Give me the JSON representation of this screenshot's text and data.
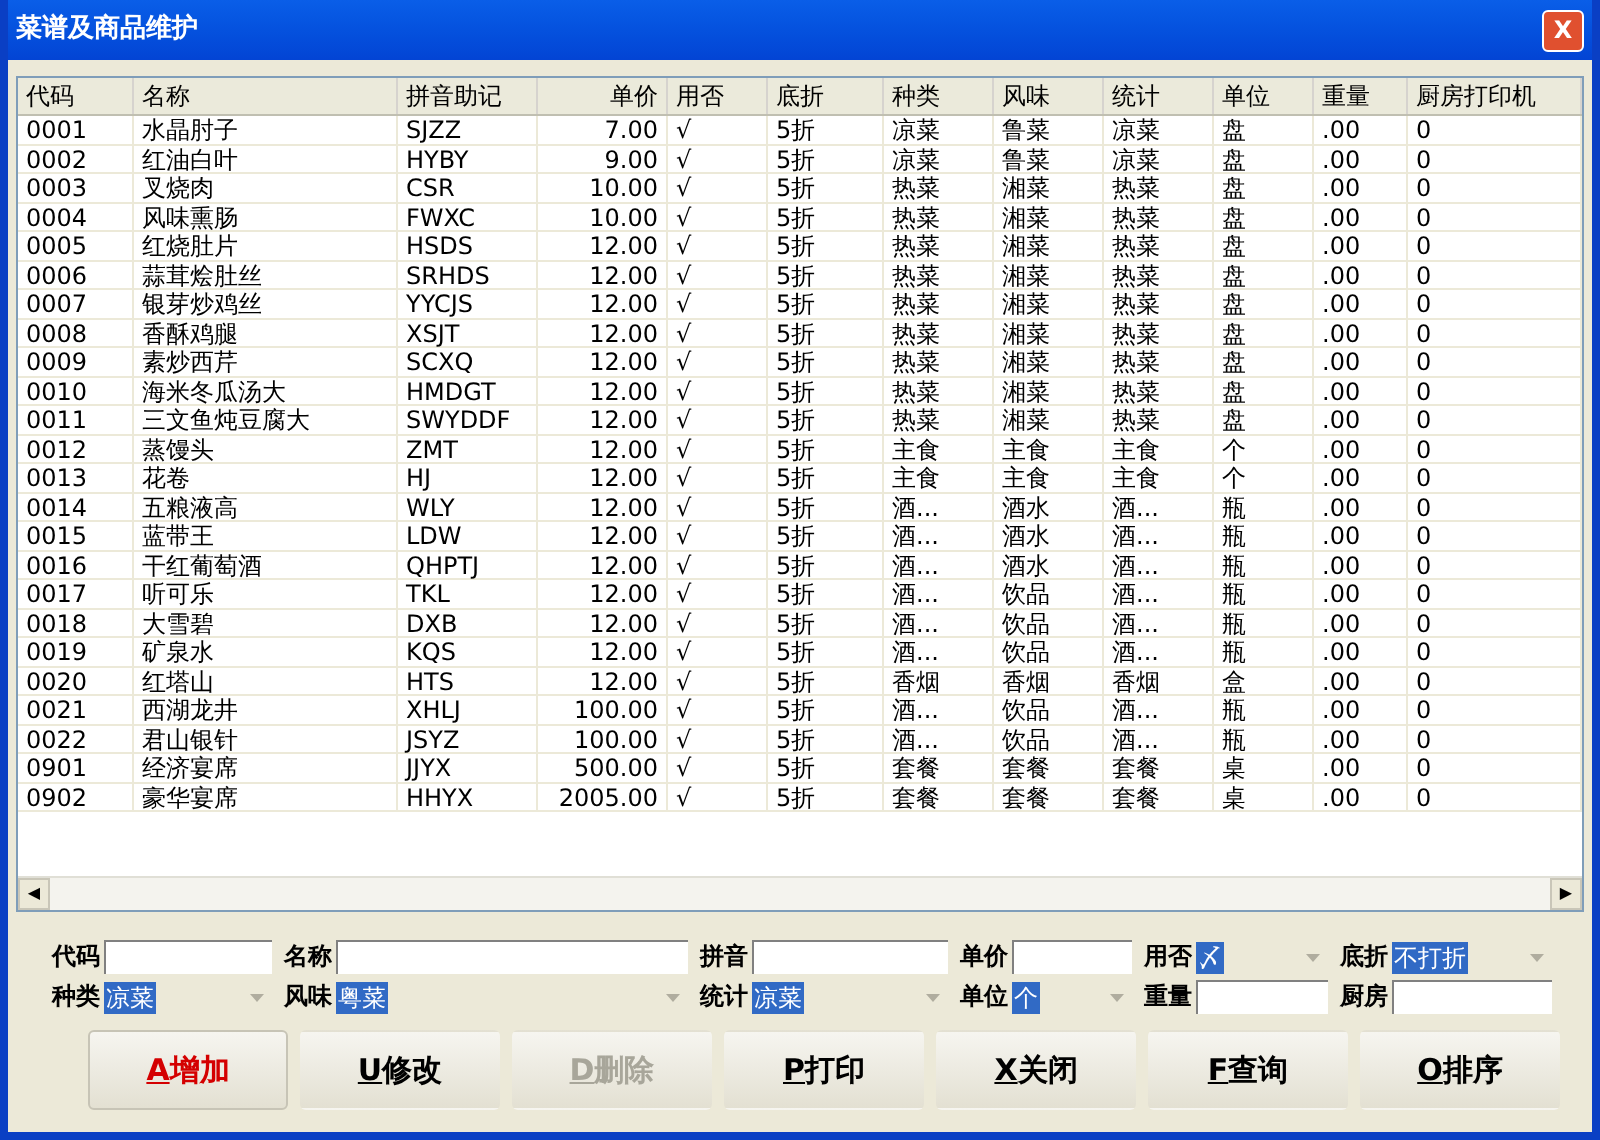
{
  "window": {
    "title": "菜谱及商品维护",
    "close": "X"
  },
  "table": {
    "columns": [
      "代码",
      "名称",
      "拼音助记",
      "单价",
      "用否",
      "底折",
      "种类",
      "风味",
      "统计",
      "单位",
      "重量",
      "厨房打印机"
    ],
    "rows": [
      [
        "0001",
        "水晶肘子",
        "SJZZ",
        "7.00",
        "√",
        "5折",
        "凉菜",
        "鲁菜",
        "凉菜",
        "盘",
        ".00",
        "0"
      ],
      [
        "0002",
        "红油白叶",
        "HYBY",
        "9.00",
        "√",
        "5折",
        "凉菜",
        "鲁菜",
        "凉菜",
        "盘",
        ".00",
        "0"
      ],
      [
        "0003",
        "叉烧肉",
        "CSR",
        "10.00",
        "√",
        "5折",
        "热菜",
        "湘菜",
        "热菜",
        "盘",
        ".00",
        "0"
      ],
      [
        "0004",
        "风味熏肠",
        "FWXC",
        "10.00",
        "√",
        "5折",
        "热菜",
        "湘菜",
        "热菜",
        "盘",
        ".00",
        "0"
      ],
      [
        "0005",
        "红烧肚片",
        "HSDS",
        "12.00",
        "√",
        "5折",
        "热菜",
        "湘菜",
        "热菜",
        "盘",
        ".00",
        "0"
      ],
      [
        "0006",
        "蒜茸烩肚丝",
        "SRHDS",
        "12.00",
        "√",
        "5折",
        "热菜",
        "湘菜",
        "热菜",
        "盘",
        ".00",
        "0"
      ],
      [
        "0007",
        "银芽炒鸡丝",
        "YYCJS",
        "12.00",
        "√",
        "5折",
        "热菜",
        "湘菜",
        "热菜",
        "盘",
        ".00",
        "0"
      ],
      [
        "0008",
        "香酥鸡腿",
        "XSJT",
        "12.00",
        "√",
        "5折",
        "热菜",
        "湘菜",
        "热菜",
        "盘",
        ".00",
        "0"
      ],
      [
        "0009",
        "素炒西芹",
        "SCXQ",
        "12.00",
        "√",
        "5折",
        "热菜",
        "湘菜",
        "热菜",
        "盘",
        ".00",
        "0"
      ],
      [
        "0010",
        "海米冬瓜汤大",
        "HMDGT",
        "12.00",
        "√",
        "5折",
        "热菜",
        "湘菜",
        "热菜",
        "盘",
        ".00",
        "0"
      ],
      [
        "0011",
        "三文鱼炖豆腐大",
        "SWYDDF",
        "12.00",
        "√",
        "5折",
        "热菜",
        "湘菜",
        "热菜",
        "盘",
        ".00",
        "0"
      ],
      [
        "0012",
        "蒸馒头",
        "ZMT",
        "12.00",
        "√",
        "5折",
        "主食",
        "主食",
        "主食",
        "个",
        ".00",
        "0"
      ],
      [
        "0013",
        "花卷",
        "HJ",
        "12.00",
        "√",
        "5折",
        "主食",
        "主食",
        "主食",
        "个",
        ".00",
        "0"
      ],
      [
        "0014",
        "五粮液高",
        "WLY",
        "12.00",
        "√",
        "5折",
        "酒...",
        "酒水",
        "酒...",
        "瓶",
        ".00",
        "0"
      ],
      [
        "0015",
        "蓝带王",
        "LDW",
        "12.00",
        "√",
        "5折",
        "酒...",
        "酒水",
        "酒...",
        "瓶",
        ".00",
        "0"
      ],
      [
        "0016",
        "干红葡萄酒",
        "QHPTJ",
        "12.00",
        "√",
        "5折",
        "酒...",
        "酒水",
        "酒...",
        "瓶",
        ".00",
        "0"
      ],
      [
        "0017",
        "听可乐",
        "TKL",
        "12.00",
        "√",
        "5折",
        "酒...",
        "饮品",
        "酒...",
        "瓶",
        ".00",
        "0"
      ],
      [
        "0018",
        "大雪碧",
        "DXB",
        "12.00",
        "√",
        "5折",
        "酒...",
        "饮品",
        "酒...",
        "瓶",
        ".00",
        "0"
      ],
      [
        "0019",
        "矿泉水",
        "KQS",
        "12.00",
        "√",
        "5折",
        "酒...",
        "饮品",
        "酒...",
        "瓶",
        ".00",
        "0"
      ],
      [
        "0020",
        "红塔山",
        "HTS",
        "12.00",
        "√",
        "5折",
        "香烟",
        "香烟",
        "香烟",
        "盒",
        ".00",
        "0"
      ],
      [
        "0021",
        "西湖龙井",
        "XHLJ",
        "100.00",
        "√",
        "5折",
        "酒...",
        "饮品",
        "酒...",
        "瓶",
        ".00",
        "0"
      ],
      [
        "0022",
        "君山银针",
        "JSYZ",
        "100.00",
        "√",
        "5折",
        "酒...",
        "饮品",
        "酒...",
        "瓶",
        ".00",
        "0"
      ],
      [
        "0901",
        "经济宴席",
        "JJYX",
        "500.00",
        "√",
        "5折",
        "套餐",
        "套餐",
        "套餐",
        "桌",
        ".00",
        "0"
      ],
      [
        "0902",
        "豪华宴席",
        "HHYX",
        "2005.00",
        "√",
        "5折",
        "套餐",
        "套餐",
        "套餐",
        "桌",
        ".00",
        "0"
      ]
    ],
    "scroll_left": "◀",
    "scroll_right": "▶"
  },
  "form": [
    [
      {
        "label": "代码",
        "kind": "text"
      },
      {
        "label": "名称",
        "kind": "text"
      },
      {
        "label": "拼音",
        "kind": "text"
      },
      {
        "label": "单价",
        "kind": "text"
      },
      {
        "label": "用否",
        "kind": "select",
        "value": "〆"
      },
      {
        "label": "底折",
        "kind": "select",
        "value": "不打折"
      }
    ],
    [
      {
        "label": "种类",
        "kind": "select",
        "value": "凉菜"
      },
      {
        "label": "风味",
        "kind": "select",
        "value": "粤菜"
      },
      {
        "label": "统计",
        "kind": "select",
        "value": "凉菜"
      },
      {
        "label": "单位",
        "kind": "select",
        "value": "个"
      },
      {
        "label": "重量",
        "kind": "text"
      },
      {
        "label": "厨房",
        "kind": "text"
      }
    ]
  ],
  "buttons": [
    {
      "hotkey": "A",
      "label": "增加",
      "default": true,
      "disabled": false
    },
    {
      "hotkey": "U",
      "label": "修改",
      "default": false,
      "disabled": false
    },
    {
      "hotkey": "D",
      "label": "删除",
      "default": false,
      "disabled": true
    },
    {
      "hotkey": "P",
      "label": "打印",
      "default": false,
      "disabled": false
    },
    {
      "hotkey": "X",
      "label": "关闭",
      "default": false,
      "disabled": false
    },
    {
      "hotkey": "F",
      "label": "查询",
      "default": false,
      "disabled": false
    },
    {
      "hotkey": "O",
      "label": "排序",
      "default": false,
      "disabled": false
    }
  ]
}
